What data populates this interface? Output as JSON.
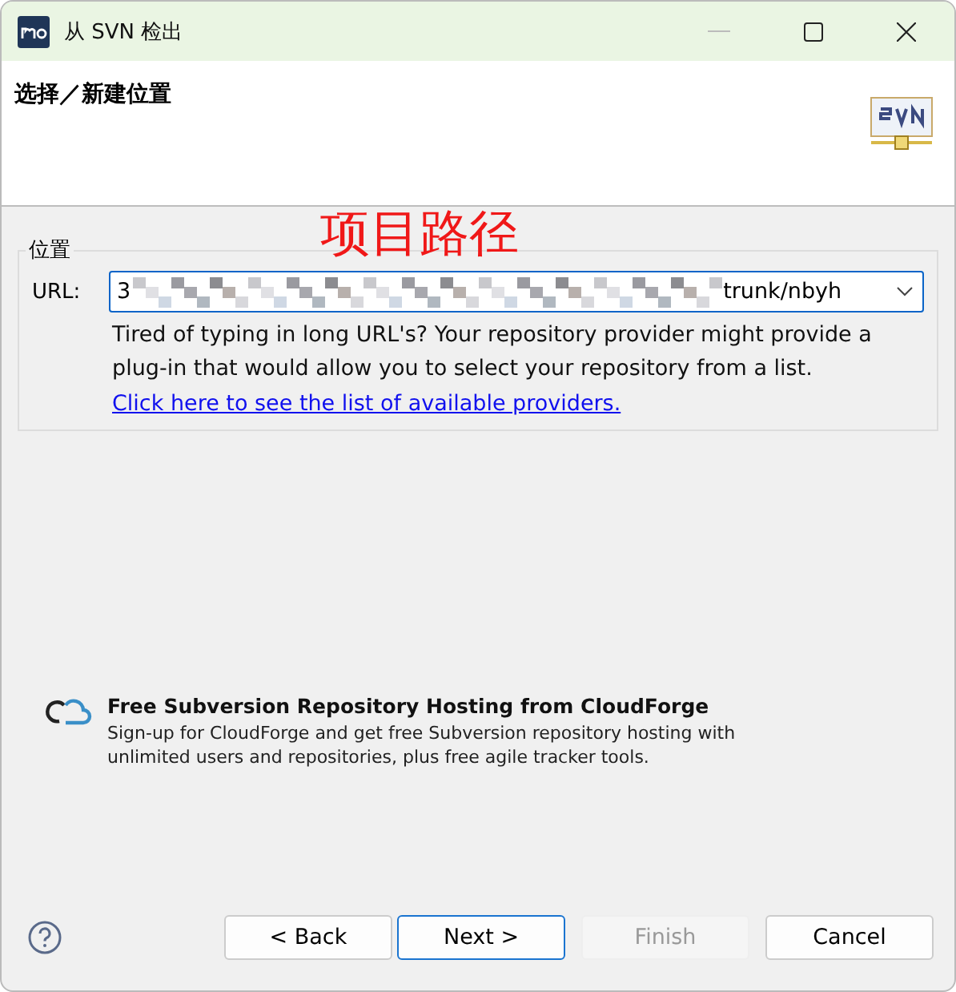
{
  "window": {
    "title": "从 SVN 检出"
  },
  "header": {
    "title": "选择／新建位置"
  },
  "annotation": "项目路径",
  "location": {
    "legend": "位置",
    "url_label": "URL:",
    "url_start": "3",
    "url_end": "trunk/nbyh",
    "hint": "Tired of typing in long URL's?  Your repository provider might provide a plug-in that would allow you to select your repository from a list.",
    "link": "Click here to see the list of available providers."
  },
  "promo": {
    "title": "Free Subversion Repository Hosting from CloudForge",
    "text": "Sign-up for CloudForge and get free Subversion repository hosting with unlimited users and repositories, plus free agile tracker tools."
  },
  "buttons": [
    {
      "label": "< Back",
      "disabled": false,
      "default": false
    },
    {
      "label": "Next >",
      "disabled": false,
      "default": true
    },
    {
      "label": "Finish",
      "disabled": true,
      "default": false
    },
    {
      "label": "Cancel",
      "disabled": false,
      "default": false
    }
  ]
}
